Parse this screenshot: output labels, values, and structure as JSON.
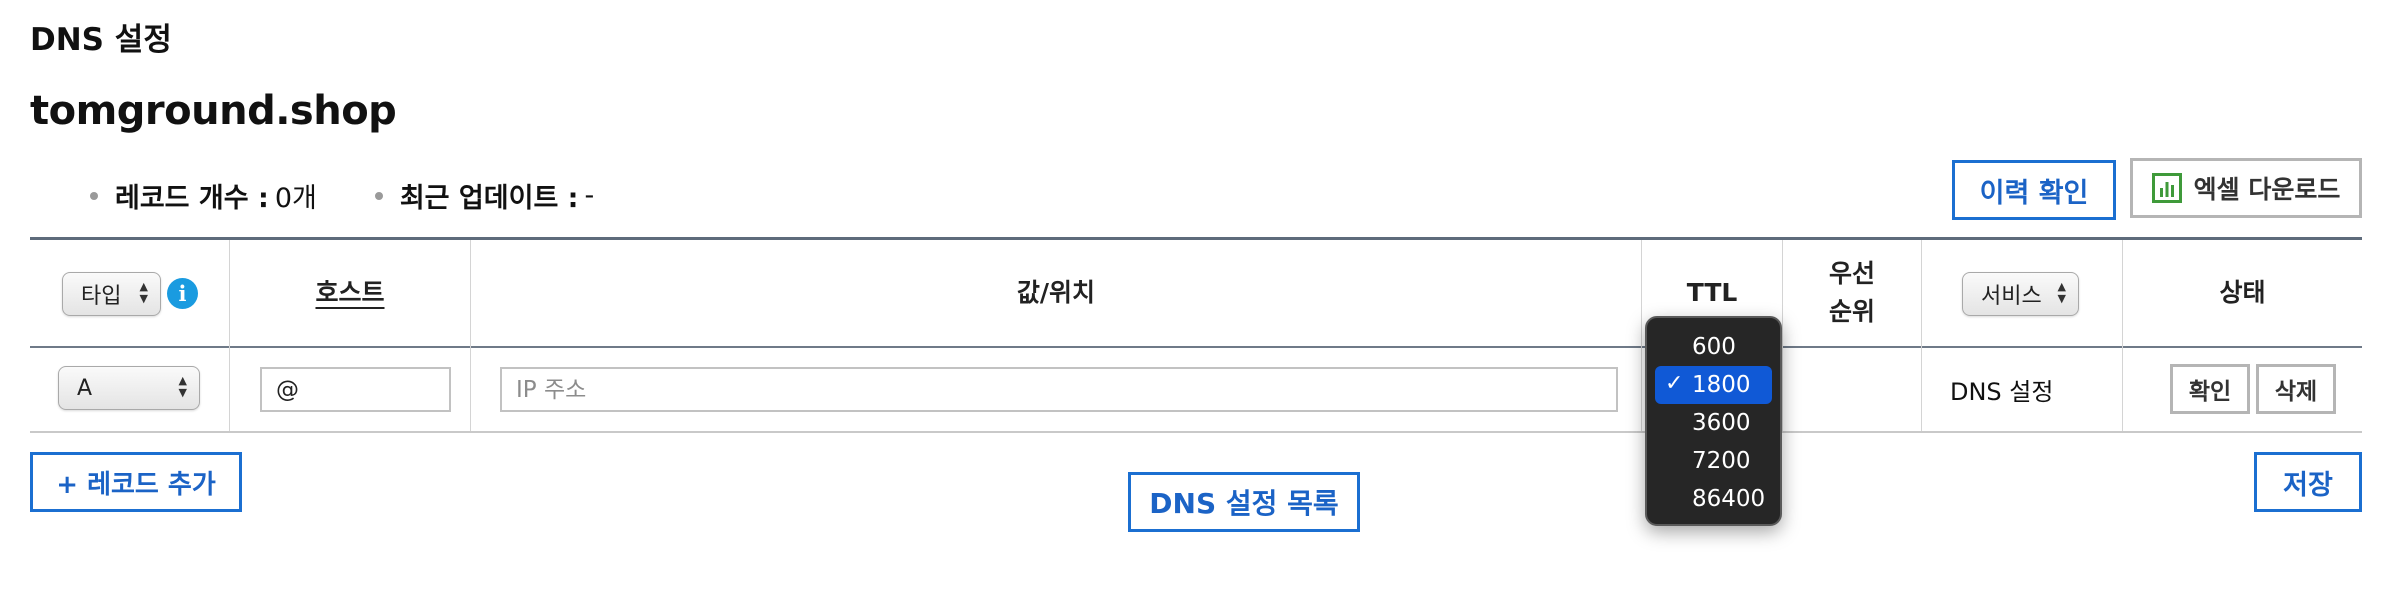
{
  "page": {
    "heading": "DNS 설정",
    "domain": "tomground.shop"
  },
  "info": {
    "record_count_label": "레코드 개수 :",
    "record_count_value": "0개",
    "last_update_label": "최근 업데이트 :",
    "last_update_value": "-"
  },
  "actions": {
    "history": "이력 확인",
    "excel": "엑셀 다운로드"
  },
  "table": {
    "headers": {
      "type_select": "타입",
      "host": "호스트",
      "value": "값/위치",
      "ttl": "TTL",
      "priority_line1": "우선",
      "priority_line2": "순위",
      "service_select": "서비스",
      "status": "상태"
    },
    "row": {
      "type": "A",
      "host": "@",
      "value_placeholder": "IP 주소",
      "service": "DNS 설정",
      "confirm": "확인",
      "delete": "삭제"
    }
  },
  "ttl_dropdown": {
    "options": [
      "600",
      "1800",
      "3600",
      "7200",
      "86400"
    ],
    "selected": "1800"
  },
  "footer": {
    "add_record": "+ 레코드 추가",
    "list": "DNS 설정 목록",
    "save": "저장"
  },
  "colors": {
    "accent": "#1b6fd1",
    "menu_selected": "#1059d6",
    "info_icon": "#1a9be0",
    "excel_icon": "#3f9a3a"
  }
}
